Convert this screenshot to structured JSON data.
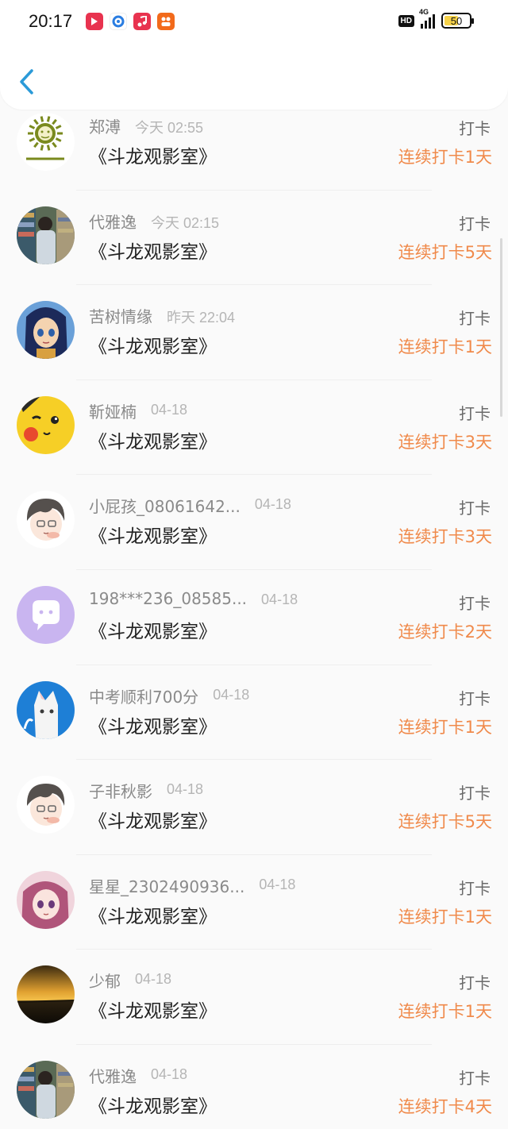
{
  "status_bar": {
    "time": "20:17",
    "network": "4G",
    "hd_label": "HD",
    "battery": "50",
    "app_icons": [
      "video-app-icon",
      "browser-app-icon",
      "music-app-icon",
      "photo-app-icon"
    ]
  },
  "header": {
    "back_icon": "chevron-left-icon"
  },
  "colors": {
    "accent_orange": "#f08a4b",
    "back_blue": "#2b9ad8"
  },
  "list": [
    {
      "name": "郑溥",
      "date": "今天 02:55",
      "title": "《斗龙观影室》",
      "action": "打卡",
      "streak": "连续打卡1天",
      "avatar": "sun-logo-avatar"
    },
    {
      "name": "代雅逸",
      "date": "今天 02:15",
      "title": "《斗龙观影室》",
      "action": "打卡",
      "streak": "连续打卡5天",
      "avatar": "bookstore-photo-avatar"
    },
    {
      "name": "苦树情缘",
      "date": "昨天 22:04",
      "title": "《斗龙观影室》",
      "action": "打卡",
      "streak": "连续打卡1天",
      "avatar": "anime-girl-avatar"
    },
    {
      "name": "靳娅楠",
      "date": "04-18",
      "title": "《斗龙观影室》",
      "action": "打卡",
      "streak": "连续打卡3天",
      "avatar": "pikachu-avatar"
    },
    {
      "name": "小屁孩_08061642...",
      "date": "04-18",
      "title": "《斗龙观影室》",
      "action": "打卡",
      "streak": "连续打卡3天",
      "avatar": "cartoon-boy-avatar"
    },
    {
      "name": "198***236_08585...",
      "date": "04-18",
      "title": "《斗龙观影室》",
      "action": "打卡",
      "streak": "连续打卡2天",
      "avatar": "default-chat-avatar"
    },
    {
      "name": "中考顺利700分",
      "date": "04-18",
      "title": "《斗龙观影室》",
      "action": "打卡",
      "streak": "连续打卡1天",
      "avatar": "cat-boy-avatar"
    },
    {
      "name": "子非秋影",
      "date": "04-18",
      "title": "《斗龙观影室》",
      "action": "打卡",
      "streak": "连续打卡5天",
      "avatar": "cartoon-boy-avatar"
    },
    {
      "name": "星星_2302490936...",
      "date": "04-18",
      "title": "《斗龙观影室》",
      "action": "打卡",
      "streak": "连续打卡1天",
      "avatar": "pink-hair-girl-avatar"
    },
    {
      "name": "少郁",
      "date": "04-18",
      "title": "《斗龙观影室》",
      "action": "打卡",
      "streak": "连续打卡1天",
      "avatar": "sunset-avatar"
    },
    {
      "name": "代雅逸",
      "date": "04-18",
      "title": "《斗龙观影室》",
      "action": "打卡",
      "streak": "连续打卡4天",
      "avatar": "bookstore-photo-avatar"
    }
  ]
}
